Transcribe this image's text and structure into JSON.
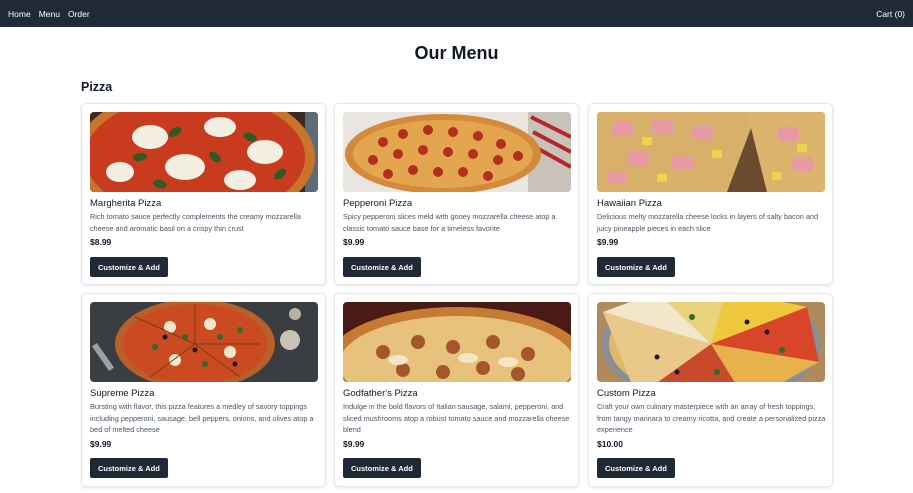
{
  "nav": {
    "links": [
      "Home",
      "Menu",
      "Order"
    ],
    "cart": "Cart (0)"
  },
  "page": {
    "title": "Our Menu",
    "section": "Pizza"
  },
  "items": [
    {
      "name": "Margherita Pizza",
      "description": "Rich tomato sauce perfectly complements the creamy mozzarella cheese and aromatic basil on a crispy thin crust",
      "price": "$8.99",
      "button": "Customize & Add"
    },
    {
      "name": "Pepperoni Pizza",
      "description": "Spicy pepperoni slices meld with gooey mozzarella cheese atop a classic tomato sauce base for a timeless favorite",
      "price": "$9.99",
      "button": "Customize & Add"
    },
    {
      "name": "Hawaiian Pizza",
      "description": "Delicious melty mozzarella cheese locks in layers of salty bacon and juicy pineapple pieces in each slice",
      "price": "$9.99",
      "button": "Customize & Add"
    },
    {
      "name": "Supreme Pizza",
      "description": "Bursting with flavor, this pizza features a medley of savory toppings including pepperoni, sausage, bell peppers, onions, and olives atop a bed of melted cheese",
      "price": "$9.99",
      "button": "Customize & Add"
    },
    {
      "name": "Godfather's Pizza",
      "description": "Indulge in the bold flavors of Italian sausage, salami, pepperoni, and sliced mushrooms atop a robust tomato sauce and mozzarella cheese blend",
      "price": "$9.99",
      "button": "Customize & Add"
    },
    {
      "name": "Custom Pizza",
      "description": "Craft your own culinary masterpiece with an array of fresh toppings, from tangy marinara to creamy ricotta, and create a personalized pizza experience",
      "price": "$10.00",
      "button": "Customize & Add"
    }
  ],
  "colors": {
    "nav_bg": "#1f2937",
    "button_bg": "#1f2937",
    "text": "#111827",
    "muted_text": "#4b5563"
  }
}
